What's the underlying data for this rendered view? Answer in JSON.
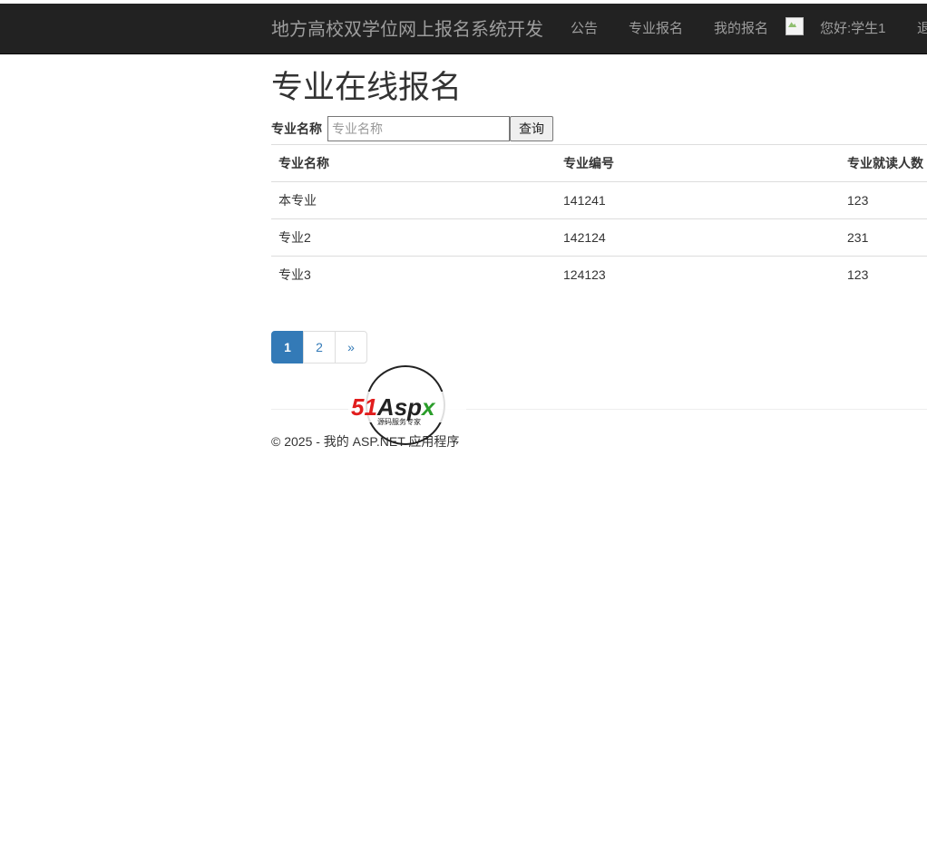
{
  "navbar": {
    "brand": "地方高校双学位网上报名系统开发",
    "links": [
      "公告",
      "专业报名",
      "我的报名"
    ],
    "greeting": "您好:学生1",
    "logout": "退"
  },
  "page": {
    "title": "专业在线报名"
  },
  "search": {
    "label": "专业名称",
    "placeholder": "专业名称",
    "button": "查询"
  },
  "table": {
    "headers": [
      "专业名称",
      "专业编号",
      "专业就读人数"
    ],
    "rows": [
      [
        "本专业",
        "141241",
        "123"
      ],
      [
        "专业2",
        "142124",
        "231"
      ],
      [
        "专业3",
        "124123",
        "123"
      ]
    ]
  },
  "pager": {
    "pages": [
      "1",
      "2",
      "»"
    ],
    "active": "1"
  },
  "footer": {
    "text": "© 2025 - 我的 ASP.NET 应用程序"
  },
  "watermark": {
    "logo_text": "51Aspx",
    "tagline": "源码服务专家",
    "colors": {
      "51": "#e11d1d",
      "Asp": "#222222",
      "x": "#2a9d2a"
    }
  }
}
